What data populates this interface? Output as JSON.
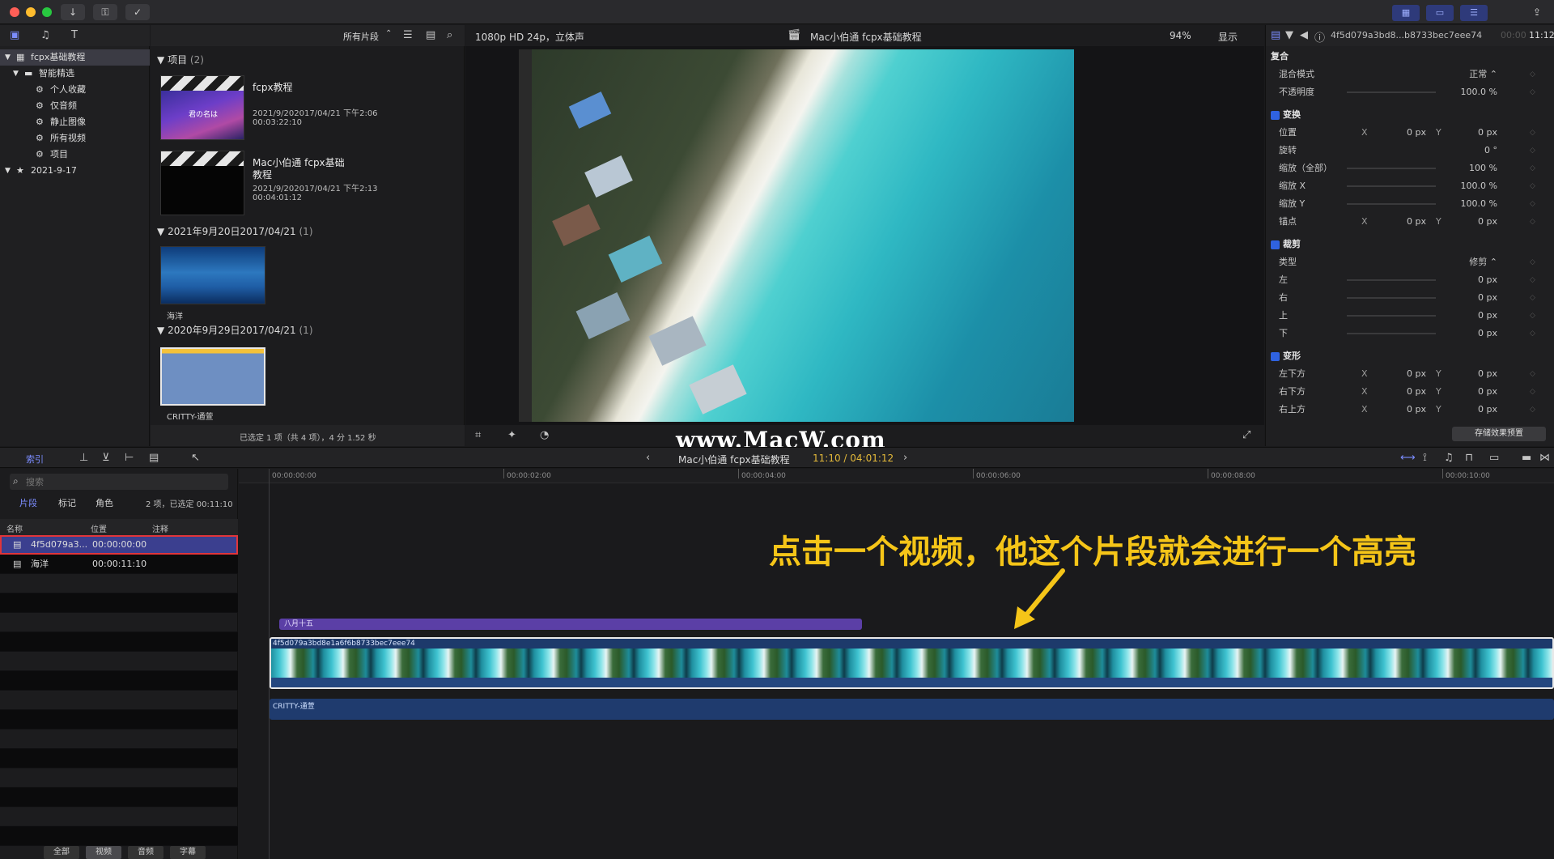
{
  "window": {
    "traffic": [
      "close",
      "minimize",
      "zoom"
    ]
  },
  "sidebar": {
    "items": [
      {
        "label": "fcpx基础教程",
        "icon": "library-icon",
        "level": 0
      },
      {
        "label": "智能精选",
        "icon": "folder-icon",
        "level": 1
      },
      {
        "label": "个人收藏",
        "icon": "gear-icon",
        "level": 2
      },
      {
        "label": "仅音频",
        "icon": "gear-icon",
        "level": 2
      },
      {
        "label": "静止图像",
        "icon": "gear-icon",
        "level": 2
      },
      {
        "label": "所有视频",
        "icon": "gear-icon",
        "level": 2
      },
      {
        "label": "项目",
        "icon": "gear-icon",
        "level": 2
      },
      {
        "label": "2021-9-17",
        "icon": "event-icon",
        "level": 0
      }
    ]
  },
  "browser": {
    "filter_label": "所有片段",
    "groups": [
      {
        "header": "项目",
        "count": "(2)"
      },
      {
        "header": "2021年9月20日2017/04/21",
        "count": "(1)"
      },
      {
        "header": "2020年9月29日2017/04/21",
        "count": "(1)"
      }
    ],
    "projects": [
      {
        "title": "fcpx教程",
        "date": "2021/9/202017/04/21 下午2:06",
        "duration": "00:03:22:10",
        "thumb_text": "君の名は"
      },
      {
        "title_line1": "Mac小伯通 fcpx基础",
        "title_line2": "教程",
        "date": "2021/9/202017/04/21 下午2:13",
        "duration": "00:04:01:12"
      }
    ],
    "clips": [
      {
        "label": "海洋"
      },
      {
        "label": "CRITTY-通萱"
      }
    ],
    "status": "已选定 1 项（共 4 项），4 分 1.52 秒"
  },
  "viewer": {
    "format": "1080p HD 24p，立体声",
    "title": "Mac小伯通 fcpx基础教程",
    "zoom": "94%",
    "display": "显示",
    "watermark": "www.MacW.com"
  },
  "inspector": {
    "clip_name": "4f5d079a3bd8...b8733bec7eee74",
    "timecode_dim": "00:00",
    "timecode": "11:12",
    "composite": {
      "title": "复合",
      "blend_label": "混合模式",
      "blend_value": "正常 ⌃",
      "opacity_label": "不透明度",
      "opacity_value": "100.0 %"
    },
    "transform": {
      "title": "变换",
      "position_label": "位置",
      "position_x": "0 px",
      "position_y": "0 px",
      "rotation_label": "旋转",
      "rotation_value": "0 °",
      "scale_all_label": "缩放（全部）",
      "scale_all_value": "100 %",
      "scale_x_label": "缩放 X",
      "scale_x_value": "100.0 %",
      "scale_y_label": "缩放 Y",
      "scale_y_value": "100.0 %",
      "anchor_label": "锚点",
      "anchor_x": "0 px",
      "anchor_y": "0 px"
    },
    "crop": {
      "title": "裁剪",
      "type_label": "类型",
      "type_value": "修剪 ⌃",
      "left_label": "左",
      "right_label": "右",
      "top_label": "上",
      "bottom_label": "下",
      "value": "0 px"
    },
    "distort": {
      "title": "变形",
      "bl_label": "左下方",
      "br_label": "右下方",
      "tr_label": "右上方",
      "value": "0 px"
    },
    "save_preset": "存储效果预置",
    "axis_x": "X",
    "axis_y": "Y"
  },
  "timeline_toolbar": {
    "index_label": "索引",
    "project_title": "Mac小伯通 fcpx基础教程",
    "timecode": "11:10 / 04:01:12"
  },
  "index_panel": {
    "search_placeholder": "搜索",
    "tabs": [
      "片段",
      "标记",
      "角色"
    ],
    "summary": "2 项，已选定 00:11:10",
    "columns": [
      "名称",
      "位置",
      "注释"
    ],
    "rows": [
      {
        "name": "4f5d079a3...",
        "position": "00:00:00:00"
      },
      {
        "name": "海洋",
        "position": "00:00:11:10"
      }
    ],
    "footer": [
      "全部",
      "视频",
      "音频",
      "字幕"
    ]
  },
  "timeline": {
    "ruler": [
      "00:00:00:00",
      "00:00:02:00",
      "00:00:04:00",
      "00:00:06:00",
      "00:00:08:00",
      "00:00:10:00"
    ],
    "title_clip": "八月十五",
    "video_clip": "4f5d079a3bd8e1a6f6b8733bec7eee74",
    "audio_clip": "CRITTY-通萱",
    "annotation": "点击一个视频，他这个片段就会进行一个高亮"
  },
  "colors": {
    "accent_blue": "#2f62e0",
    "annotation_yellow": "#f5c518",
    "title_purple": "#5b3fa6",
    "highlight_red": "#e0353a"
  }
}
